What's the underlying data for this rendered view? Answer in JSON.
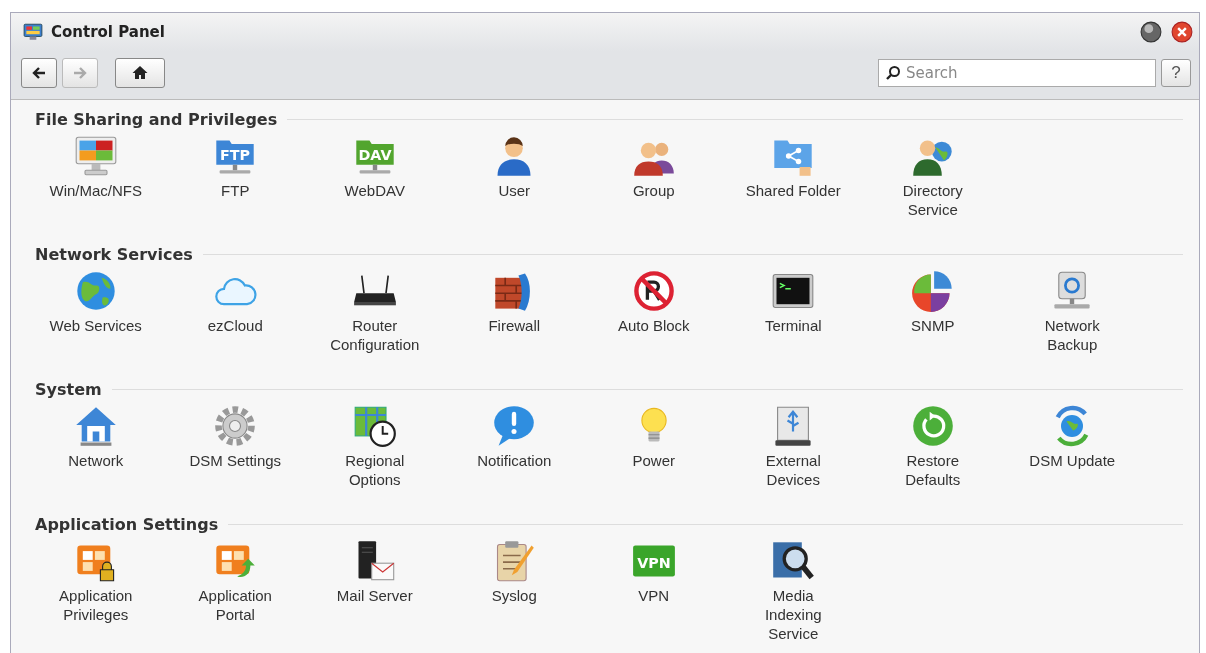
{
  "window": {
    "title": "Control Panel"
  },
  "toolbar": {
    "back_disabled": false,
    "forward_disabled": true,
    "search": {
      "placeholder": "Search"
    },
    "help": "?"
  },
  "sections": [
    {
      "title": "File Sharing and Privileges",
      "items": [
        {
          "label": "Win/Mac/NFS"
        },
        {
          "label": "FTP",
          "badge": "FTP"
        },
        {
          "label": "WebDAV",
          "badge": "DAV"
        },
        {
          "label": "User"
        },
        {
          "label": "Group"
        },
        {
          "label": "Shared Folder"
        },
        {
          "label": "Directory Service"
        }
      ]
    },
    {
      "title": "Network Services",
      "items": [
        {
          "label": "Web Services"
        },
        {
          "label": "ezCloud"
        },
        {
          "label": "Router Configuration"
        },
        {
          "label": "Firewall"
        },
        {
          "label": "Auto Block"
        },
        {
          "label": "Terminal"
        },
        {
          "label": "SNMP"
        },
        {
          "label": "Network Backup"
        }
      ]
    },
    {
      "title": "System",
      "items": [
        {
          "label": "Network"
        },
        {
          "label": "DSM Settings"
        },
        {
          "label": "Regional Options"
        },
        {
          "label": "Notification"
        },
        {
          "label": "Power"
        },
        {
          "label": "External Devices"
        },
        {
          "label": "Restore Defaults"
        },
        {
          "label": "DSM Update"
        }
      ]
    },
    {
      "title": "Application Settings",
      "items": [
        {
          "label": "Application Privileges"
        },
        {
          "label": "Application Portal"
        },
        {
          "label": "Mail Server"
        },
        {
          "label": "Syslog"
        },
        {
          "label": "VPN",
          "badge": "VPN"
        },
        {
          "label": "Media Indexing Service"
        }
      ]
    }
  ]
}
